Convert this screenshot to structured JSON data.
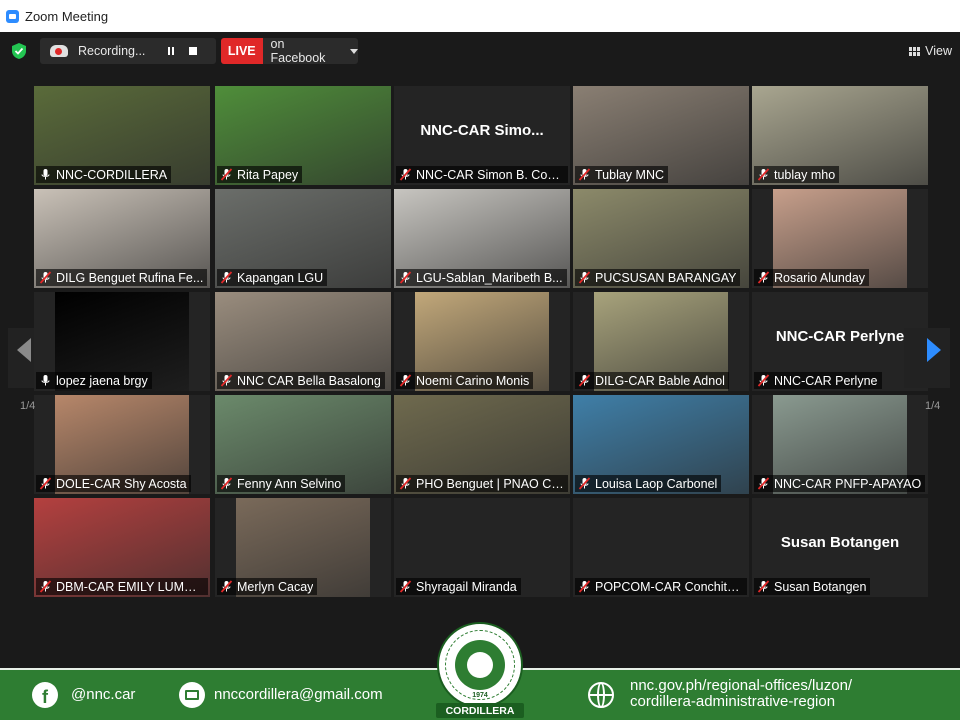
{
  "window": {
    "title": "Zoom Meeting"
  },
  "toolbar": {
    "recording_label": "Recording...",
    "live_badge": "LIVE",
    "live_target": "on Facebook",
    "view_label": "View"
  },
  "pagination": {
    "left": "1/4",
    "right": "1/4"
  },
  "participants": [
    {
      "name": "NNC-CORDILLERA",
      "video": true,
      "active": true,
      "muted": false,
      "bg": "#5a6b3a"
    },
    {
      "name": "Rita Papey",
      "video": true,
      "muted": true,
      "bg": "#4f8e3a"
    },
    {
      "name": "NNC-CAR Simon B. Cop...",
      "video": false,
      "muted": true,
      "display": "NNC-CAR  Simo..."
    },
    {
      "name": "Tublay MNC",
      "video": true,
      "muted": true,
      "bg": "#8a7f73"
    },
    {
      "name": "tublay mho",
      "video": true,
      "muted": true,
      "bg": "#a9a690"
    },
    {
      "name": "DILG Benguet Rufina Fe...",
      "video": true,
      "muted": true,
      "bg": "#c9c1b7"
    },
    {
      "name": "Kapangan LGU",
      "video": true,
      "muted": true,
      "bg": "#6b6e6a"
    },
    {
      "name": "LGU-Sablan_Maribeth B...",
      "video": true,
      "muted": true,
      "bg": "#c7c5c0"
    },
    {
      "name": "PUCSUSAN BARANGAY",
      "video": true,
      "muted": true,
      "bg": "#8c8a6a"
    },
    {
      "name": "Rosario Alunday",
      "video": true,
      "muted": true,
      "bg": "#c79f8b",
      "narrow": true
    },
    {
      "name": "lopez jaena brgy",
      "video": true,
      "muted": false,
      "bg": "#000000",
      "narrow": true
    },
    {
      "name": "NNC CAR Bella Basalong",
      "video": true,
      "muted": true,
      "bg": "#9a8d7e"
    },
    {
      "name": "Noemi Carino Monis",
      "video": true,
      "muted": true,
      "bg": "#c2a87a",
      "narrow": true
    },
    {
      "name": "DILG-CAR Bable Adnol",
      "video": true,
      "muted": true,
      "bg": "#a8a37c",
      "narrow": true
    },
    {
      "name": "NNC-CAR Perlyne",
      "video": false,
      "muted": true,
      "display": "NNC-CAR Perlyne"
    },
    {
      "name": "DOLE-CAR Shy Acosta",
      "video": true,
      "muted": true,
      "bg": "#b7876a",
      "narrow": true
    },
    {
      "name": "Fenny Ann Selvino",
      "video": true,
      "muted": true,
      "bg": "#6b8a6b"
    },
    {
      "name": "PHO Benguet | PNAO Ca...",
      "video": true,
      "muted": true,
      "bg": "#6f6a4e"
    },
    {
      "name": "Louisa Laop Carbonel",
      "video": true,
      "muted": true,
      "bg": "#3f7fa8"
    },
    {
      "name": "NNC-CAR PNFP-APAYAO",
      "video": true,
      "muted": true,
      "bg": "#8a9a90",
      "narrow": true
    },
    {
      "name": "DBM-CAR EMILY LUMPIO",
      "video": true,
      "muted": true,
      "bg": "#b4403f"
    },
    {
      "name": "Merlyn Cacay",
      "video": true,
      "muted": true,
      "bg": "#7a6a5a",
      "narrow": true
    },
    {
      "name": "Shyragail Miranda",
      "video": false,
      "muted": true,
      "display": ""
    },
    {
      "name": "POPCOM-CAR Conchita ...",
      "video": false,
      "muted": true,
      "display": ""
    },
    {
      "name": "Susan Botangen",
      "video": false,
      "muted": true,
      "display": "Susan Botangen"
    }
  ],
  "footer": {
    "facebook": "@nnc.car",
    "email": "nnccordillera@gmail.com",
    "website_line1": "nnc.gov.ph/regional-offices/luzon/",
    "website_line2": "cordillera-administrative-region",
    "seal_year": "1974",
    "seal_tag": "CORDILLERA"
  },
  "colors": {
    "footer_green": "#2e7d32",
    "active_border": "#c8d93a",
    "live_red": "#e02828",
    "arrow_blue": "#2d8cff"
  }
}
